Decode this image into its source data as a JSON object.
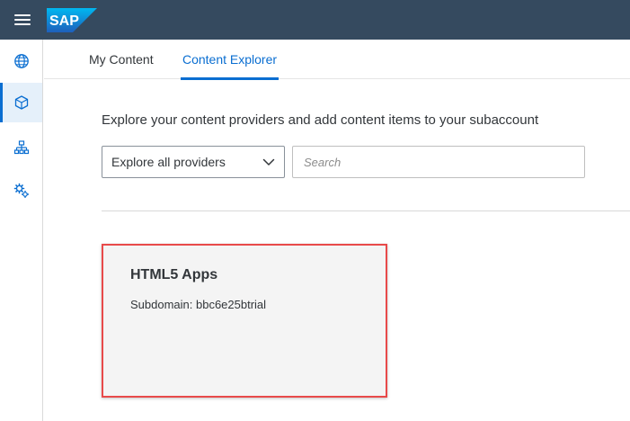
{
  "shell": {
    "logo_text": "SAP",
    "brand_color": "#0a6ed1",
    "header_color": "#354a5f"
  },
  "sidenav": {
    "items": [
      {
        "icon": "globe-icon",
        "active": false
      },
      {
        "icon": "cube-icon",
        "active": true
      },
      {
        "icon": "hierarchy-icon",
        "active": false
      },
      {
        "icon": "settings-gears-icon",
        "active": false
      }
    ]
  },
  "tabs": {
    "my_content": "My Content",
    "content_explorer": "Content Explorer",
    "selected": "Content Explorer"
  },
  "main": {
    "heading": "Explore your content providers and add content items to your subaccount",
    "provider_select": {
      "value": "Explore all providers"
    },
    "search": {
      "placeholder": "Search",
      "value": ""
    }
  },
  "cards": [
    {
      "title": "HTML5 Apps",
      "subtitle": "Subdomain: bbc6e25btrial",
      "highlight_color": "#e84a4a"
    }
  ]
}
